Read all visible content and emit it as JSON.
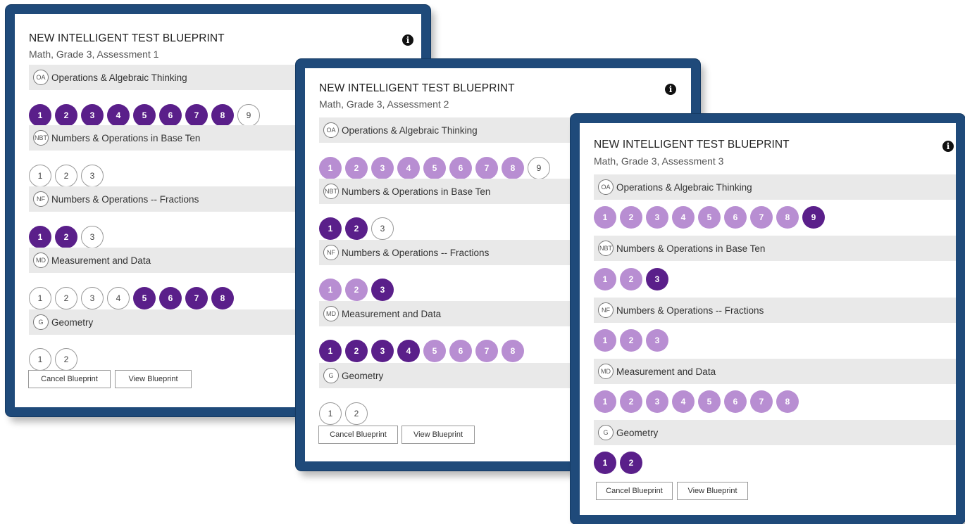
{
  "cards": [
    {
      "title": "NEW INTELLIGENT TEST BLUEPRINT",
      "subtitle": "Math, Grade 3, Assessment 1",
      "info_icon": "i",
      "cancel_label": "Cancel Blueprint",
      "view_label": "View Blueprint",
      "sections": [
        {
          "abbr": "OA",
          "name": "Operations & Algebraic Thinking",
          "items": [
            {
              "n": "1",
              "s": "dark"
            },
            {
              "n": "2",
              "s": "dark"
            },
            {
              "n": "3",
              "s": "dark"
            },
            {
              "n": "4",
              "s": "dark"
            },
            {
              "n": "5",
              "s": "dark"
            },
            {
              "n": "6",
              "s": "dark"
            },
            {
              "n": "7",
              "s": "dark"
            },
            {
              "n": "8",
              "s": "dark"
            },
            {
              "n": "9",
              "s": "empty"
            }
          ]
        },
        {
          "abbr": "NBT",
          "name": "Numbers & Operations in Base Ten",
          "items": [
            {
              "n": "1",
              "s": "empty"
            },
            {
              "n": "2",
              "s": "empty"
            },
            {
              "n": "3",
              "s": "empty"
            }
          ]
        },
        {
          "abbr": "NF",
          "name": "Numbers & Operations -- Fractions",
          "items": [
            {
              "n": "1",
              "s": "dark"
            },
            {
              "n": "2",
              "s": "dark"
            },
            {
              "n": "3",
              "s": "empty"
            }
          ]
        },
        {
          "abbr": "MD",
          "name": "Measurement and Data",
          "items": [
            {
              "n": "1",
              "s": "empty"
            },
            {
              "n": "2",
              "s": "empty"
            },
            {
              "n": "3",
              "s": "empty"
            },
            {
              "n": "4",
              "s": "empty"
            },
            {
              "n": "5",
              "s": "dark"
            },
            {
              "n": "6",
              "s": "dark"
            },
            {
              "n": "7",
              "s": "dark"
            },
            {
              "n": "8",
              "s": "dark"
            }
          ]
        },
        {
          "abbr": "G",
          "name": "Geometry",
          "items": [
            {
              "n": "1",
              "s": "empty"
            },
            {
              "n": "2",
              "s": "empty"
            }
          ]
        }
      ]
    },
    {
      "title": "NEW INTELLIGENT TEST BLUEPRINT",
      "subtitle": "Math, Grade 3, Assessment 2",
      "info_icon": "i",
      "cancel_label": "Cancel Blueprint",
      "view_label": "View Blueprint",
      "sections": [
        {
          "abbr": "OA",
          "name": "Operations & Algebraic Thinking",
          "items": [
            {
              "n": "1",
              "s": "light"
            },
            {
              "n": "2",
              "s": "light"
            },
            {
              "n": "3",
              "s": "light"
            },
            {
              "n": "4",
              "s": "light"
            },
            {
              "n": "5",
              "s": "light"
            },
            {
              "n": "6",
              "s": "light"
            },
            {
              "n": "7",
              "s": "light"
            },
            {
              "n": "8",
              "s": "light"
            },
            {
              "n": "9",
              "s": "empty"
            }
          ]
        },
        {
          "abbr": "NBT",
          "name": "Numbers & Operations in Base Ten",
          "items": [
            {
              "n": "1",
              "s": "dark"
            },
            {
              "n": "2",
              "s": "dark"
            },
            {
              "n": "3",
              "s": "empty"
            }
          ]
        },
        {
          "abbr": "NF",
          "name": "Numbers & Operations -- Fractions",
          "items": [
            {
              "n": "1",
              "s": "light"
            },
            {
              "n": "2",
              "s": "light"
            },
            {
              "n": "3",
              "s": "dark"
            }
          ]
        },
        {
          "abbr": "MD",
          "name": "Measurement and Data",
          "items": [
            {
              "n": "1",
              "s": "dark"
            },
            {
              "n": "2",
              "s": "dark"
            },
            {
              "n": "3",
              "s": "dark"
            },
            {
              "n": "4",
              "s": "dark"
            },
            {
              "n": "5",
              "s": "light"
            },
            {
              "n": "6",
              "s": "light"
            },
            {
              "n": "7",
              "s": "light"
            },
            {
              "n": "8",
              "s": "light"
            }
          ]
        },
        {
          "abbr": "G",
          "name": "Geometry",
          "items": [
            {
              "n": "1",
              "s": "empty"
            },
            {
              "n": "2",
              "s": "empty"
            }
          ]
        }
      ]
    },
    {
      "title": "NEW INTELLIGENT TEST BLUEPRINT",
      "subtitle": "Math, Grade 3, Assessment 3",
      "info_icon": "i",
      "cancel_label": "Cancel Blueprint",
      "view_label": "View Blueprint",
      "sections": [
        {
          "abbr": "OA",
          "name": "Operations & Algebraic Thinking",
          "items": [
            {
              "n": "1",
              "s": "light"
            },
            {
              "n": "2",
              "s": "light"
            },
            {
              "n": "3",
              "s": "light"
            },
            {
              "n": "4",
              "s": "light"
            },
            {
              "n": "5",
              "s": "light"
            },
            {
              "n": "6",
              "s": "light"
            },
            {
              "n": "7",
              "s": "light"
            },
            {
              "n": "8",
              "s": "light"
            },
            {
              "n": "9",
              "s": "dark"
            }
          ]
        },
        {
          "abbr": "NBT",
          "name": "Numbers & Operations in Base Ten",
          "items": [
            {
              "n": "1",
              "s": "light"
            },
            {
              "n": "2",
              "s": "light"
            },
            {
              "n": "3",
              "s": "dark"
            }
          ]
        },
        {
          "abbr": "NF",
          "name": "Numbers & Operations -- Fractions",
          "items": [
            {
              "n": "1",
              "s": "light"
            },
            {
              "n": "2",
              "s": "light"
            },
            {
              "n": "3",
              "s": "light"
            }
          ]
        },
        {
          "abbr": "MD",
          "name": "Measurement and Data",
          "items": [
            {
              "n": "1",
              "s": "light"
            },
            {
              "n": "2",
              "s": "light"
            },
            {
              "n": "3",
              "s": "light"
            },
            {
              "n": "4",
              "s": "light"
            },
            {
              "n": "5",
              "s": "light"
            },
            {
              "n": "6",
              "s": "light"
            },
            {
              "n": "7",
              "s": "light"
            },
            {
              "n": "8",
              "s": "light"
            }
          ]
        },
        {
          "abbr": "G",
          "name": "Geometry",
          "items": [
            {
              "n": "1",
              "s": "dark"
            },
            {
              "n": "2",
              "s": "dark"
            }
          ]
        }
      ]
    }
  ],
  "colors": {
    "frame": "#1f4a7a",
    "dark_circle": "#5a1f8a",
    "light_circle": "#b88ed2",
    "section_bar": "#e9e9e9"
  }
}
